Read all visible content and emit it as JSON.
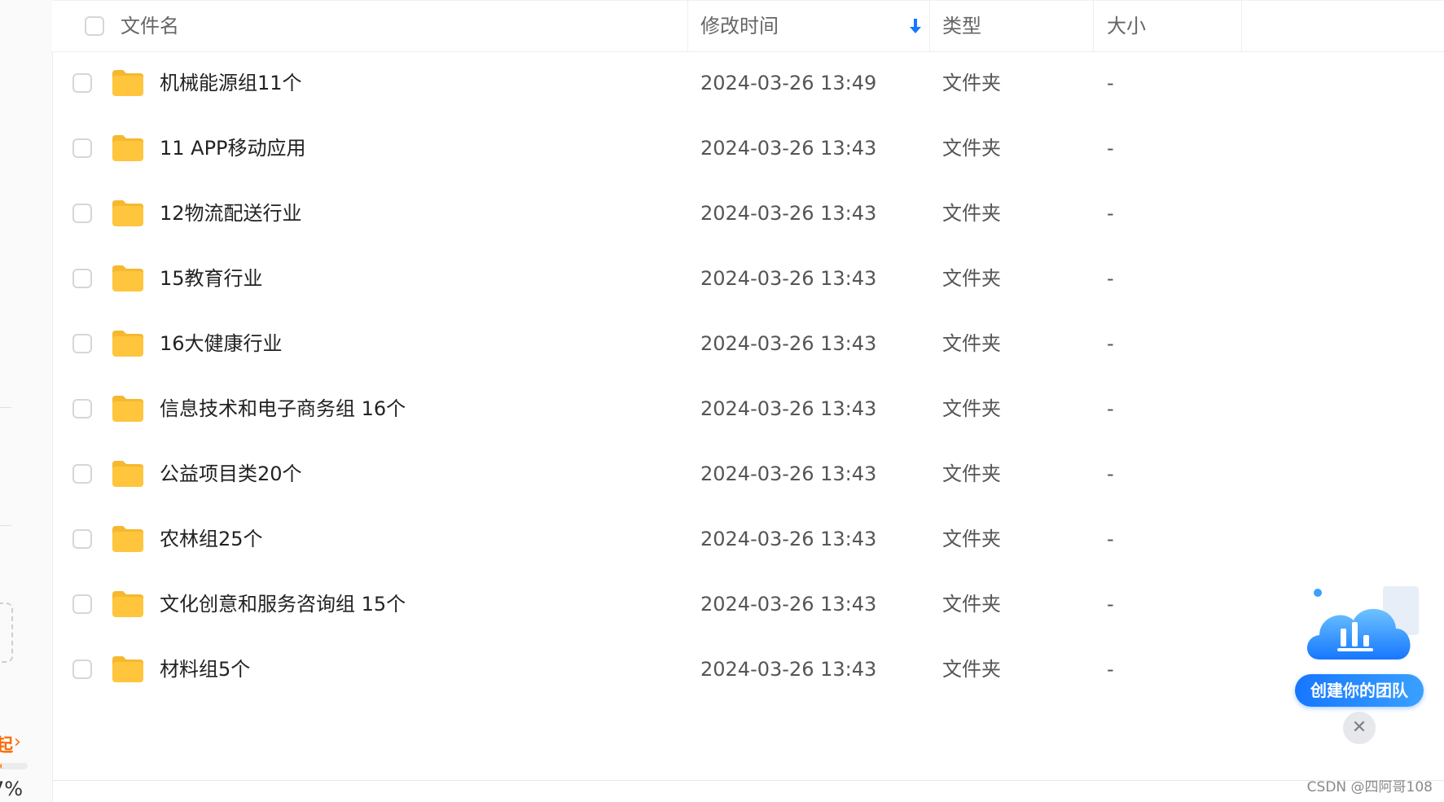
{
  "header": {
    "name_label": "文件名",
    "time_label": "修改时间",
    "type_label": "类型",
    "size_label": "大小"
  },
  "files": [
    {
      "name": "机械能源组11个",
      "modified": "2024-03-26 13:49",
      "type": "文件夹",
      "size": "-"
    },
    {
      "name": "11 APP移动应用",
      "modified": "2024-03-26 13:43",
      "type": "文件夹",
      "size": "-"
    },
    {
      "name": "12物流配送行业",
      "modified": "2024-03-26 13:43",
      "type": "文件夹",
      "size": "-"
    },
    {
      "name": "15教育行业",
      "modified": "2024-03-26 13:43",
      "type": "文件夹",
      "size": "-"
    },
    {
      "name": "16大健康行业",
      "modified": "2024-03-26 13:43",
      "type": "文件夹",
      "size": "-"
    },
    {
      "name": "信息技术和电子商务组 16个",
      "modified": "2024-03-26 13:43",
      "type": "文件夹",
      "size": "-"
    },
    {
      "name": "公益项目类20个",
      "modified": "2024-03-26 13:43",
      "type": "文件夹",
      "size": "-"
    },
    {
      "name": "农林组25个",
      "modified": "2024-03-26 13:43",
      "type": "文件夹",
      "size": "-"
    },
    {
      "name": "文化创意和服务咨询组 15个",
      "modified": "2024-03-26 13:43",
      "type": "文件夹",
      "size": "-"
    },
    {
      "name": "材料组5个",
      "modified": "2024-03-26 13:43",
      "type": "文件夹",
      "size": "-"
    }
  ],
  "sidebar": {
    "upgrade_text": "起",
    "storage_percent_text": "7%"
  },
  "promo": {
    "button_label": "创建你的团队",
    "close_glyph": "✕"
  },
  "watermark": "CSDN @四阿哥108",
  "colors": {
    "accent": "#1677ff",
    "folder": "#ffc53d",
    "upgrade": "#ff6a00"
  },
  "icons": {
    "sort": "arrow-down-icon",
    "folder": "folder-icon",
    "close": "close-icon"
  }
}
